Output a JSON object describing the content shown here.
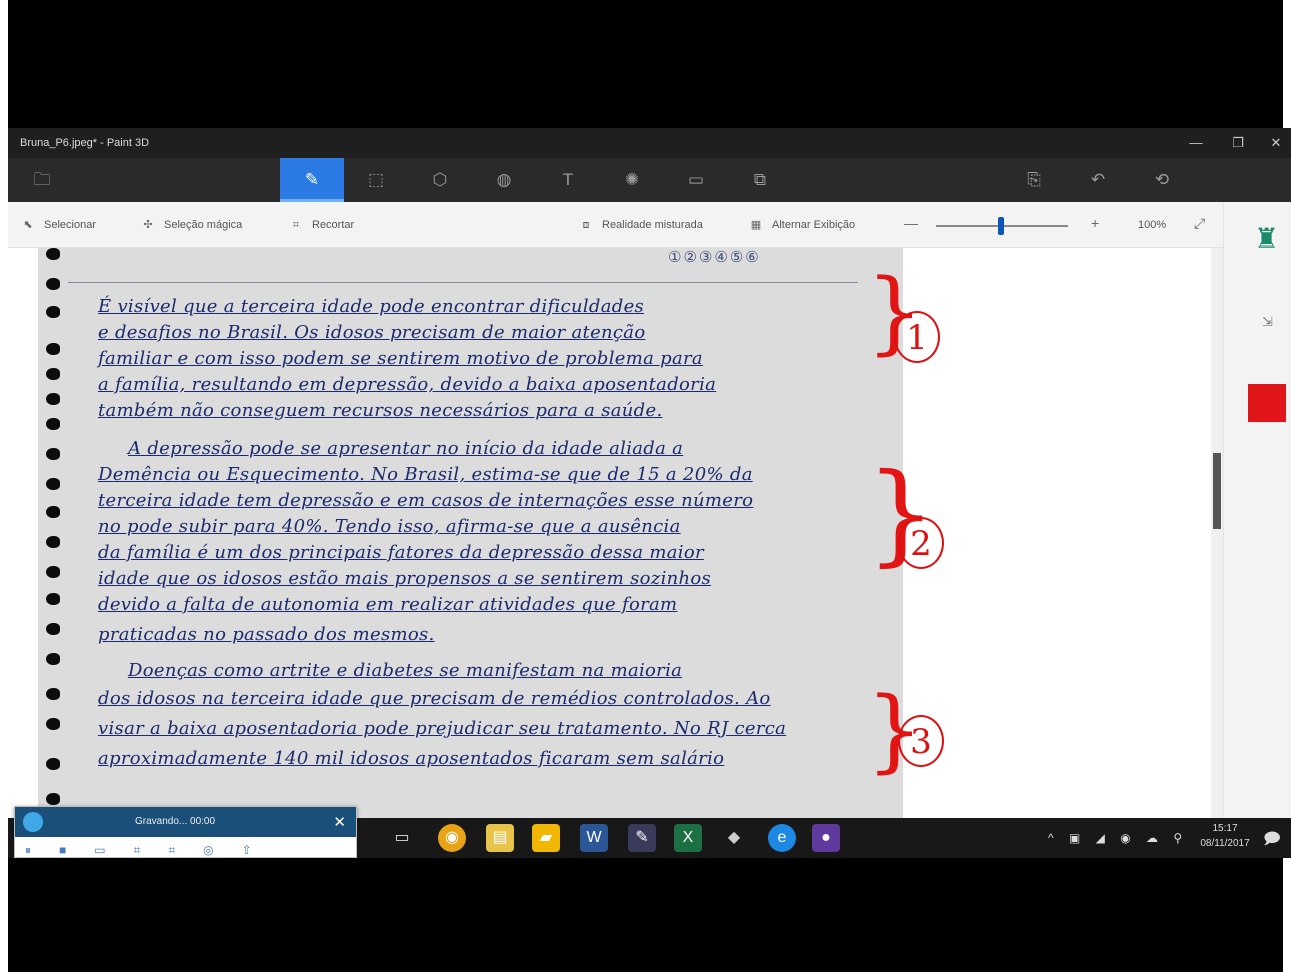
{
  "window": {
    "title": "Bruna_P6.jpeg* - Paint 3D",
    "minimize": "—",
    "maximize": "❐",
    "close": "✕"
  },
  "menubar": {
    "items": [
      {
        "icon": "folder-icon",
        "glyph": "🗀"
      },
      {
        "icon": "brush-icon",
        "glyph": "✎"
      },
      {
        "icon": "2d-shapes-icon",
        "glyph": "⬚"
      },
      {
        "icon": "3d-shapes-icon",
        "glyph": "⬡"
      },
      {
        "icon": "stickers-icon",
        "glyph": "◍"
      },
      {
        "icon": "text-icon",
        "glyph": "T"
      },
      {
        "icon": "effects-icon",
        "glyph": "✺"
      },
      {
        "icon": "canvas-icon",
        "glyph": "▭"
      },
      {
        "icon": "remix3d-icon",
        "glyph": "⧉"
      },
      {
        "icon": "paste-icon",
        "glyph": "⎘"
      },
      {
        "icon": "undo-icon",
        "glyph": "↶"
      },
      {
        "icon": "history-icon",
        "glyph": "⟲"
      }
    ]
  },
  "toolbar": {
    "select_label": "Selecionar",
    "magic_select_label": "Seleção mágica",
    "crop_label": "Recortar",
    "mixed_reality_label": "Realidade misturada",
    "toggle_2d_label": "Alternar Exibição",
    "zoom_minus": "—",
    "zoom_plus": "+",
    "zoom_level": "100%",
    "zoom": 0.5
  },
  "document": {
    "number_circles": "①②③④⑤⑥",
    "lines": [
      "É visível que a terceira idade pode encontrar dificuldades",
      "e desafios no Brasil. Os idosos precisam de maior atenção",
      "familiar e com isso podem se sentirem motivo de problema para",
      "a família, resultando em depressão, devido a baixa aposentadoria",
      "também não conseguem recursos necessários para a saúde.",
      "A depressão pode se apresentar no início da idade aliada a",
      "Demência ou Esquecimento. No Brasil, estima-se que de 15 a 20% da",
      "terceira idade tem depressão e em casos de internações esse número",
      "no pode subir para 40%. Tendo isso, afirma-se que a ausência",
      "da família é um dos principais fatores da depressão dessa maior",
      "idade que os idosos estão mais propensos a se sentirem sozinhos",
      "devido a falta de autonomia em realizar atividades que foram",
      "praticadas no passado dos mesmos.",
      "Doenças como artrite e diabetes se manifestam na maioria",
      "dos idosos na terceira idade que precisam de remédios controlados. Ao",
      "visar a baixa aposentadoria pode prejudicar seu tratamento. No RJ cerca",
      "aproximadamente 140 mil idosos aposentados ficaram sem salário"
    ],
    "annotations": [
      "1",
      "2",
      "3"
    ],
    "annotation_color": "#e21515",
    "ink_color": "#1c2a6e"
  },
  "sidepanel": {
    "active_tool": "marker-icon",
    "color_swatch": "#e0161b"
  },
  "recorder": {
    "status": "Gravando... 00:00"
  },
  "taskbar": {
    "apps": [
      "task-view",
      "chrome",
      "file-explorer",
      "sticky-notes",
      "word",
      "notepad",
      "excel",
      "eraser-app",
      "ie",
      "screen-recorder"
    ],
    "tray": "^ ▣ ◢ ◉ ☁ ⚲",
    "time": "15:17",
    "date": "08/11/2017"
  }
}
